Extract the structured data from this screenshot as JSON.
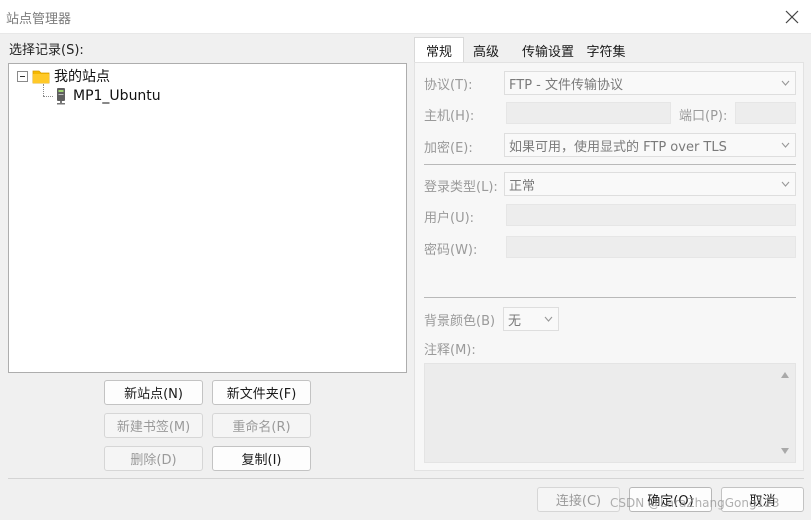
{
  "window": {
    "title": "站点管理器"
  },
  "left": {
    "select_label": "选择记录(S):",
    "tree": {
      "root_label": "我的站点",
      "child_label": "MP1_Ubuntu"
    },
    "buttons": {
      "new_site": "新站点(N)",
      "new_folder": "新文件夹(F)",
      "new_bookmark": "新建书签(M)",
      "rename": "重命名(R)",
      "delete": "删除(D)",
      "copy": "复制(I)"
    }
  },
  "tabs": [
    "常规",
    "高级",
    "传输设置",
    "字符集"
  ],
  "general": {
    "protocol_label": "协议(T):",
    "protocol_value": "FTP - 文件传输协议",
    "host_label": "主机(H):",
    "host_value": "",
    "port_label": "端口(P):",
    "port_value": "",
    "encryption_label": "加密(E):",
    "encryption_value": "如果可用，使用显式的 FTP over TLS",
    "logon_type_label": "登录类型(L):",
    "logon_type_value": "正常",
    "user_label": "用户(U):",
    "user_value": "",
    "password_label": "密码(W):",
    "password_value": "",
    "bg_color_label": "背景颜色(B)",
    "bg_color_value": "无",
    "comments_label": "注释(M):",
    "comments_value": ""
  },
  "footer": {
    "connect": "连接(C)",
    "ok": "确定(O)",
    "cancel": "取消"
  },
  "watermark": "CSDN @LaraZhangGong123",
  "icons": {
    "close": "close-icon",
    "folder": "folder-icon",
    "server": "server-icon",
    "dropdown": "chevron-down-icon"
  },
  "colors": {
    "folder": "#f5b800",
    "disabled_text": "#9a9a9a"
  }
}
